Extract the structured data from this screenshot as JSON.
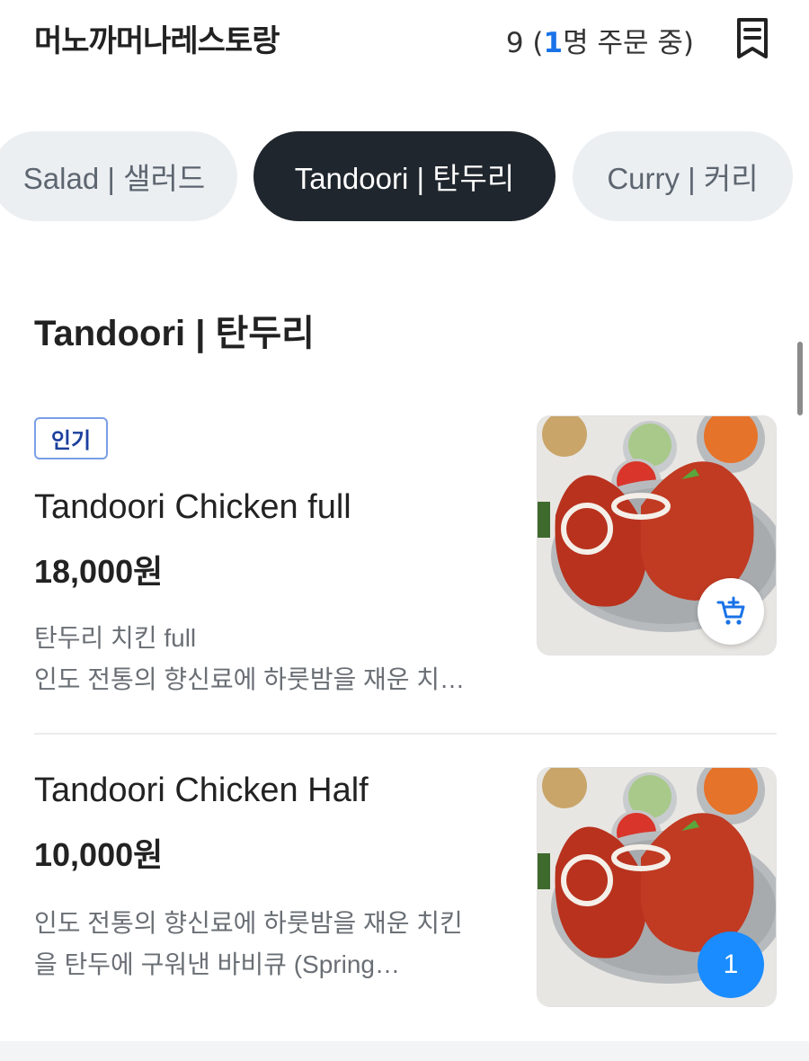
{
  "header": {
    "store_name": "머노까머나레스토랑",
    "order_count": "9 (",
    "order_people": "1",
    "order_suffix": "명 주문 중)",
    "receipt_icon": "receipt-icon"
  },
  "tabs": [
    {
      "label": "Salad | 샐러드",
      "active": false
    },
    {
      "label": "Tandoori | 탄두리",
      "active": true
    },
    {
      "label": "Curry | 커리",
      "active": false
    }
  ],
  "section": {
    "title": "Tandoori | 탄두리"
  },
  "items": [
    {
      "badge": "인기",
      "name": "Tandoori Chicken full",
      "price": "18,000원",
      "desc_lines": [
        "탄두리 치킨 full",
        "인도 전통의 향신료에 하룻밤을 재운 치…"
      ],
      "action_icon": "add-to-cart-icon"
    },
    {
      "name": "Tandoori Chicken Half",
      "price": "10,000원",
      "desc_lines": [
        "인도 전통의 향신료에 하룻밤을 재운 치킨",
        "을 탄두에 구워낸 바비큐 (Spring…"
      ],
      "quantity": "1"
    }
  ],
  "colors": {
    "accent_blue": "#1a73e8",
    "active_tab": "#20262d",
    "inactive_tab": "#eceff2",
    "badge_border": "#7a9ee6",
    "qty_badge": "#1a8cff"
  }
}
